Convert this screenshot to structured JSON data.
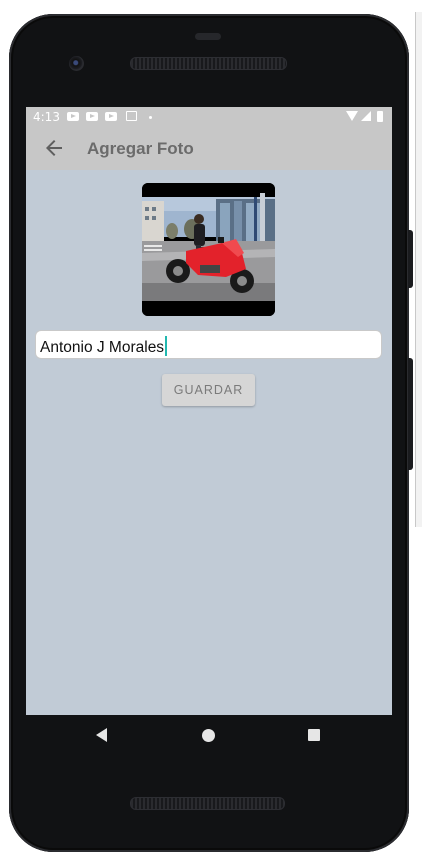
{
  "status_bar": {
    "time": "4:13",
    "icons": [
      "youtube-notification-icon",
      "youtube-notification-icon",
      "youtube-notification-icon",
      "gmail-icon",
      "more-notifications-dot-icon",
      "wifi-icon",
      "cell-signal-icon",
      "battery-icon"
    ]
  },
  "app_bar": {
    "title": "Agregar Foto",
    "back_icon": "arrow-left-icon"
  },
  "form": {
    "name_value": "Antonio J Morales",
    "save_label": "GUARDAR"
  },
  "nav_bar": {
    "icons": [
      "nav-back-icon",
      "nav-home-icon",
      "nav-recents-icon"
    ]
  },
  "colors": {
    "screen_background": "#c1cbd6",
    "app_bar": "#c7c7c7",
    "caret": "#22b8b0",
    "motorcycle": "#e3222b"
  }
}
